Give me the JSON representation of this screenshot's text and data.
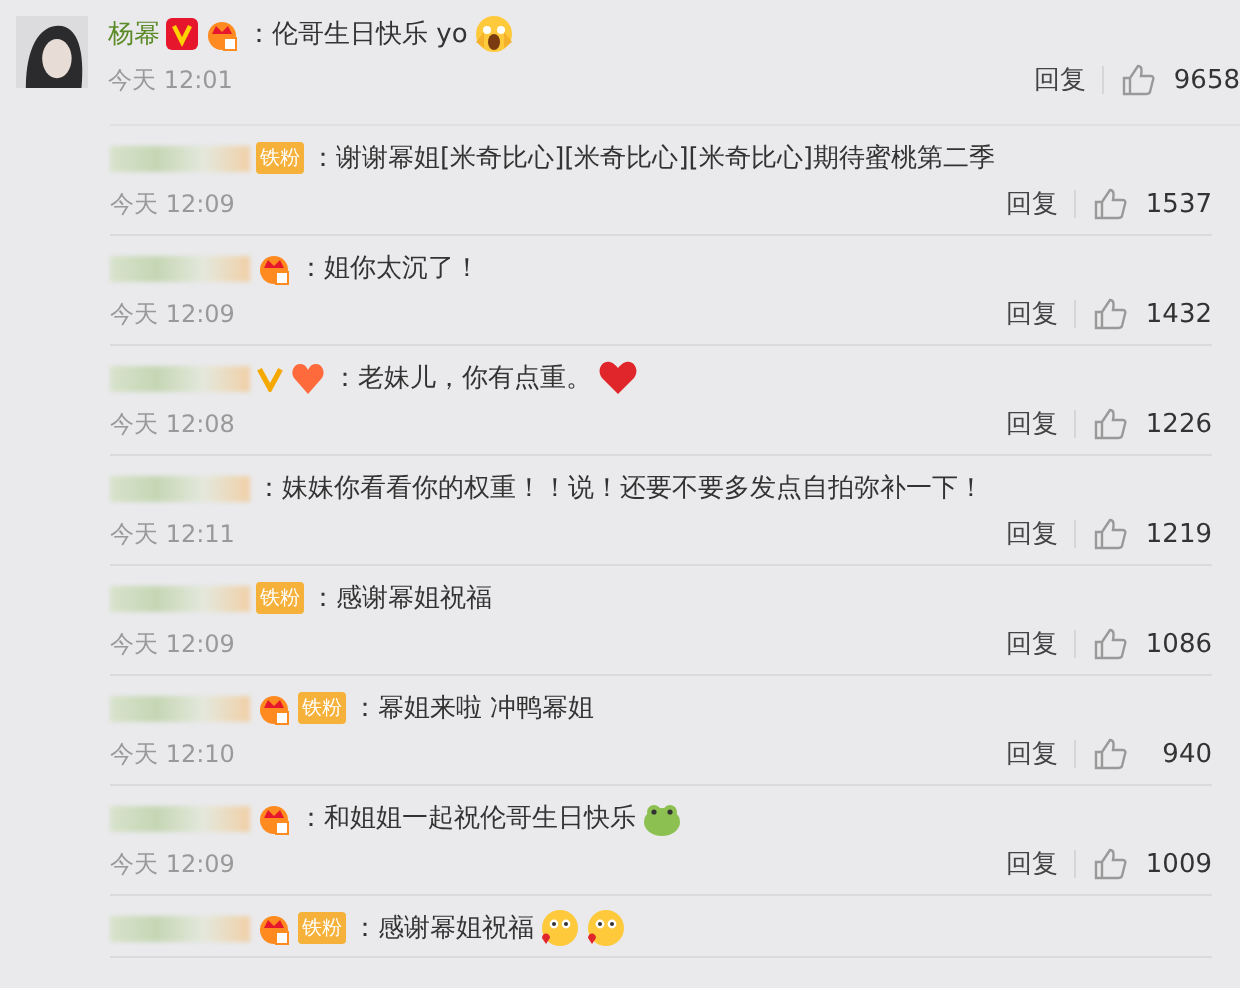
{
  "comment": {
    "name": "杨幂",
    "badges": [
      {
        "kind": "vip"
      },
      {
        "kind": "crown"
      }
    ],
    "text": "：伦哥生日快乐 yo",
    "emojis": [
      {
        "kind": "scream"
      }
    ],
    "time": "今天 12:01",
    "reply": "回复",
    "likes": "9658"
  },
  "replies": [
    {
      "badges": [
        {
          "kind": "fan",
          "label": "铁粉"
        }
      ],
      "text": "：谢谢幂姐[米奇比心][米奇比心][米奇比心]期待蜜桃第二季",
      "time": "今天 12:09",
      "reply": "回复",
      "likes": "1537"
    },
    {
      "badges": [
        {
          "kind": "crown"
        }
      ],
      "text": "：姐你太沉了！",
      "time": "今天 12:09",
      "reply": "回复",
      "likes": "1432"
    },
    {
      "badges": [
        {
          "kind": "vip"
        },
        {
          "kind": "heart-crown"
        }
      ],
      "text": "：老妹儿，你有点重。",
      "emojis": [
        {
          "kind": "heart"
        }
      ],
      "time": "今天 12:08",
      "reply": "回复",
      "likes": "1226"
    },
    {
      "text": "：妹妹你看看你的权重！！说！还要不要多发点自拍弥补一下！",
      "time": "今天 12:11",
      "reply": "回复",
      "likes": "1219"
    },
    {
      "badges": [
        {
          "kind": "fan",
          "label": "铁粉"
        }
      ],
      "text": "：感谢幂姐祝福",
      "time": "今天 12:09",
      "reply": "回复",
      "likes": "1086"
    },
    {
      "badges": [
        {
          "kind": "crown"
        },
        {
          "kind": "fan",
          "label": "铁粉"
        }
      ],
      "text": "：幂姐来啦 冲鸭幂姐",
      "time": "今天 12:10",
      "reply": "回复",
      "likes": "940"
    },
    {
      "badges": [
        {
          "kind": "crown"
        }
      ],
      "text": "：和姐姐一起祝伦哥生日快乐",
      "emojis": [
        {
          "kind": "frog"
        }
      ],
      "time": "今天 12:09",
      "reply": "回复",
      "likes": "1009"
    },
    {
      "badges": [
        {
          "kind": "crown"
        },
        {
          "kind": "fan",
          "label": "铁粉"
        }
      ],
      "text": "：感谢幂姐祝福",
      "emojis": [
        {
          "kind": "blush"
        },
        {
          "kind": "blush"
        }
      ]
    }
  ]
}
